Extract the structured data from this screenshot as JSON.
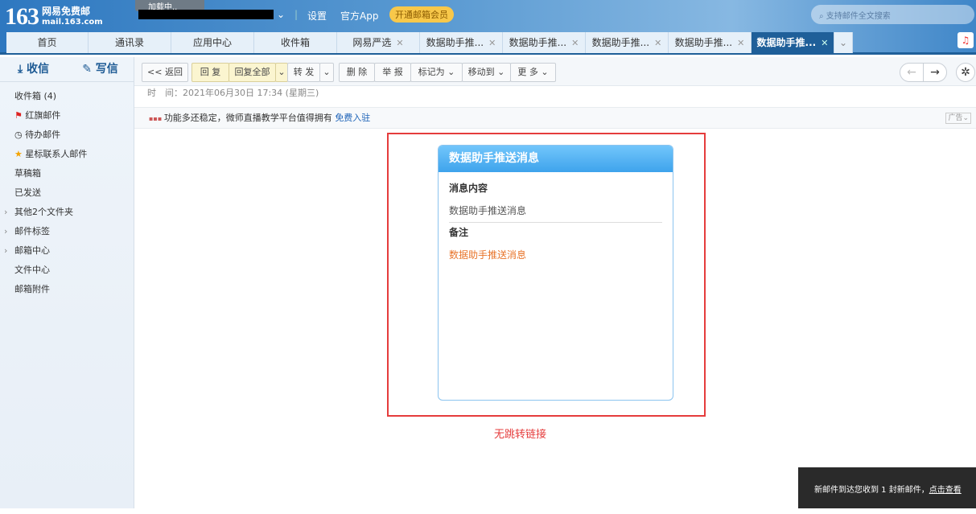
{
  "header": {
    "logo_num": "163",
    "logo_cn": "网易免费邮",
    "logo_en": "mail.163.com",
    "loading": "加载中..",
    "settings": "设置",
    "app": "官方App",
    "vip": "开通邮箱会员",
    "search_placeholder": "支持邮件全文搜索"
  },
  "tabs": [
    {
      "label": "首页"
    },
    {
      "label": "通讯录"
    },
    {
      "label": "应用中心"
    },
    {
      "label": "收件箱"
    },
    {
      "label": "网易严选",
      "closable": true
    },
    {
      "label": "数据助手推...",
      "closable": true
    },
    {
      "label": "数据助手推...",
      "closable": true
    },
    {
      "label": "数据助手推...",
      "closable": true
    },
    {
      "label": "数据助手推...",
      "closable": true
    },
    {
      "label": "数据助手推...",
      "closable": true,
      "active": true
    }
  ],
  "sidebar": {
    "receive": "收信",
    "compose": "写信",
    "items": [
      {
        "label": "收件箱 (4)"
      },
      {
        "label": "红旗邮件",
        "icon": "flag-icon"
      },
      {
        "label": "待办邮件",
        "icon": "clock-icon"
      },
      {
        "label": "星标联系人邮件",
        "icon": "star-icon"
      },
      {
        "label": "草稿箱"
      },
      {
        "label": "已发送"
      },
      {
        "label": "其他2个文件夹",
        "expandable": true
      },
      {
        "label": "邮件标签",
        "expandable": true
      },
      {
        "label": "邮箱中心",
        "expandable": true
      },
      {
        "label": "文件中心"
      },
      {
        "label": "邮箱附件"
      }
    ]
  },
  "toolbar": {
    "back": "<< 返回",
    "reply": "回 复",
    "reply_all": "回复全部",
    "forward": "转 发",
    "delete": "删 除",
    "report": "举 报",
    "mark": "标记为",
    "move": "移动到",
    "more": "更 多"
  },
  "mail": {
    "time": "时　间：2021年06月30日 17:34 (星期三)",
    "ad_text": "功能多还稳定，微师直播教学平台值得拥有",
    "ad_link": "免费入驻",
    "ad_tag": "广告",
    "card_title": "数据助手推送消息",
    "content_label": "消息内容",
    "content_value": "数据助手推送消息",
    "note_label": "备注",
    "note_value": "数据助手推送消息"
  },
  "annotation": "无跳转链接",
  "toast": {
    "text": "新邮件到达您收到 1 封新邮件，",
    "link": "点击查看"
  },
  "colors": {
    "accent": "#1f5f99",
    "annotation": "#e53c3c",
    "note": "#e8742a"
  }
}
